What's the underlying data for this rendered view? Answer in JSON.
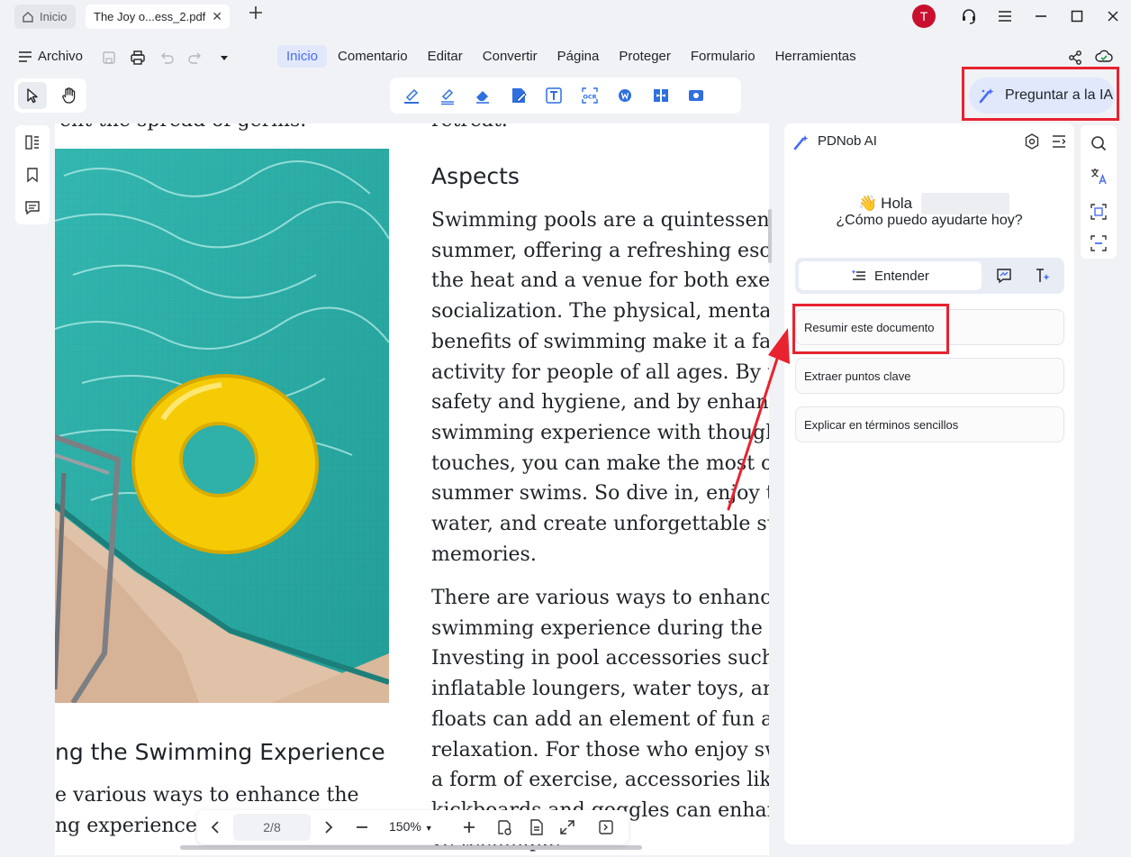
{
  "titlebar": {
    "home_tab": "Inicio",
    "doc_tab": "The Joy o...ess_2.pdf",
    "avatar_letter": "T"
  },
  "menubar": {
    "file_label": "Archivo",
    "items": [
      "Inicio",
      "Comentario",
      "Editar",
      "Convertir",
      "Página",
      "Proteger",
      "Formulario",
      "Herramientas"
    ],
    "active_index": 0
  },
  "toolbar": {
    "ask_ai_label": "Preguntar a la IA",
    "ocr_label": "OCR"
  },
  "document": {
    "top_right_fragment": "retreat.",
    "top_left_fragment": "ent the spread of germs.",
    "heading": "Aspects",
    "paragraph1": [
      "Swimming pools are a quintessential",
      "summer, offering a refreshing escape",
      "the heat and a venue for both exercis",
      "socialization. The physical, mental, an",
      "benefits of swimming make it a favor",
      "activity for people of all ages. By prio",
      "safety and hygiene, and by enhancing",
      "swimming experience with thoughtfu",
      "touches, you can make the most out o",
      "summer swims. So dive in, enjoy the",
      "water, and create unforgettable summ",
      "memories."
    ],
    "paragraph2": [
      "There are various ways to enhance th",
      "swimming experience during the sum",
      "Investing in pool accessories such as",
      "inflatable loungers, water toys, and p",
      "floats can add an element of fun and",
      "relaxation. For those who enjoy swim",
      "a form of exercise, accessories like sw",
      "kickboards and goggles can enhance",
      "ve technique"
    ],
    "left_heading": "ng the Swimming Experience",
    "left_lines": [
      "e various ways to enhance the",
      "ng experience du"
    ]
  },
  "bottom_nav": {
    "page": "2/8",
    "zoom": "150%"
  },
  "ai_panel": {
    "title": "PDNob AI",
    "wave": "👋",
    "greeting": "Hola",
    "question": "¿Cómo puedo ayudarte hoy?",
    "mode_active": "Entender",
    "suggestions": [
      "Resumir este documento",
      "Extraer puntos clave",
      "Explicar en términos sencillos"
    ]
  },
  "colors": {
    "accent": "#4a6cf7",
    "highlight_box": "#e8232f",
    "avatar": "#c8102e"
  }
}
